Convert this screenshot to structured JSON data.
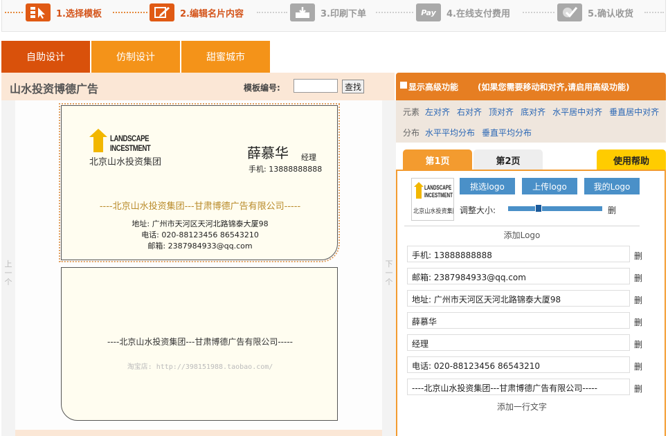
{
  "steps": [
    {
      "label": "1.选择模板",
      "icon": "template-cursor-icon",
      "state": "active"
    },
    {
      "label": "2.编辑名片内容",
      "icon": "edit-pencil-icon",
      "state": "active"
    },
    {
      "label": "3.印刷下单",
      "icon": "print-download-icon",
      "state": "inactive"
    },
    {
      "label": "4.在线支付费用",
      "icon": "pay-icon",
      "pay_text": "Pay",
      "state": "inactive"
    },
    {
      "label": "5.确认收货",
      "icon": "confirm-check-icon",
      "state": "inactive"
    }
  ],
  "main_tabs": [
    {
      "label": "自助设计",
      "active": true
    },
    {
      "label": "仿制设计",
      "active": false
    },
    {
      "label": "甜蜜城市",
      "active": false
    }
  ],
  "template": {
    "title": "山水投资博德广告",
    "code_label": "模板编号:",
    "code_value": "",
    "search_label": "查找"
  },
  "nav": {
    "prev": "上一个",
    "next": "下一个"
  },
  "card_front": {
    "logo_en_line1": "LANDSCAPE",
    "logo_en_line2": "INCESTMENT",
    "logo_cn": "北京山水投资集团",
    "name": "薛慕华",
    "title": "经理",
    "phone": "手机: 13888888888",
    "company": "----北京山水投资集团---甘肃博德广告有限公司-----",
    "address": "地址: 广州市天河区天河北路锦泰大厦98",
    "tel": "电话: 020-88123456   86543210",
    "email": "邮箱: 2387984933@qq.com"
  },
  "card_back": {
    "company": "----北京山水投资集团---甘肃博德广告有限公司-----",
    "shop": "淘宝店: http://398151988.taobao.com/"
  },
  "advanced": {
    "label": "显示高级功能",
    "note": "(如果您需要移动和对齐,请启用高级功能)",
    "checked": false
  },
  "align": {
    "element_label": "元素",
    "element_actions": [
      "左对齐",
      "右对齐",
      "顶对齐",
      "底对齐",
      "水平居中对齐",
      "垂直居中对齐"
    ],
    "distribute_label": "分布",
    "distribute_actions": [
      "水平平均分布",
      "垂直平均分布"
    ]
  },
  "page_tabs": [
    {
      "label": "第1页",
      "active": true
    },
    {
      "label": "第2页",
      "active": false
    }
  ],
  "help_label": "使用帮助",
  "logo_panel": {
    "buttons": [
      "挑选logo",
      "上传logo",
      "我的Logo"
    ],
    "size_label": "调整大小:",
    "size_value": 0.31,
    "delete_label": "删",
    "add_logo": "添加Logo"
  },
  "fields": [
    {
      "value": "手机: 13888888888",
      "delete": "删"
    },
    {
      "value": "邮箱: 2387984933@qq.com",
      "delete": "删"
    },
    {
      "value": "地址: 广州市天河区天河北路锦泰大厦98",
      "delete": "删"
    },
    {
      "value": "薛慕华",
      "delete": "删"
    },
    {
      "value": "经理",
      "delete": "删"
    },
    {
      "value": "电话: 020-88123456   86543210",
      "delete": "删"
    },
    {
      "value": "----北京山水投资集团---甘肃博德广告有限公司-----",
      "delete": "删"
    }
  ],
  "add_line": "添加一行文字",
  "colors": {
    "brand_orange": "#f49319",
    "active_tab": "#d9510b",
    "link_blue": "#2a67b5",
    "button_blue": "#4a90c8",
    "help_yellow": "#ffcc00"
  }
}
